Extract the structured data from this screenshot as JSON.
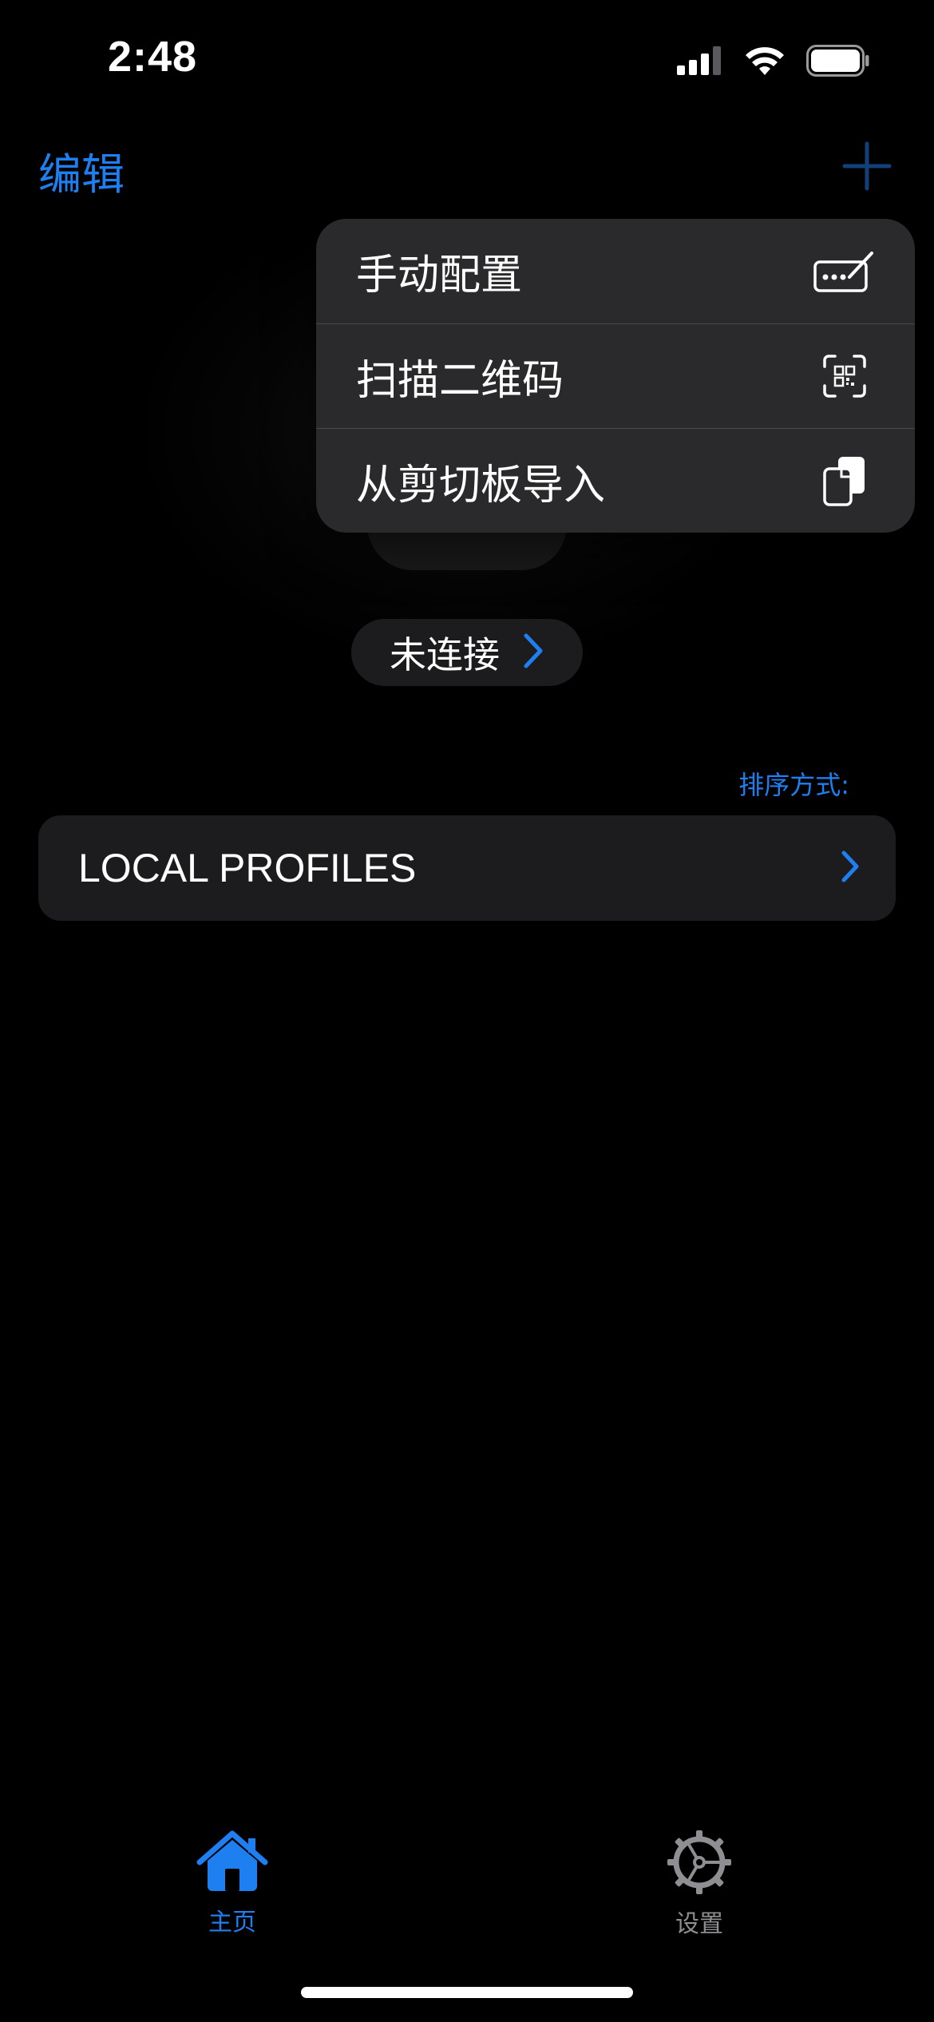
{
  "status_bar": {
    "time": "2:48",
    "signal_icon": "cellular-signal-icon",
    "wifi_icon": "wifi-icon",
    "battery_icon": "battery-icon"
  },
  "nav": {
    "edit_label": "编辑",
    "add_icon": "plus-icon"
  },
  "add_menu": {
    "items": [
      {
        "label": "手动配置",
        "icon": "edit-config-icon"
      },
      {
        "label": "扫描二维码",
        "icon": "qr-scan-icon"
      },
      {
        "label": "从剪切板导入",
        "icon": "clipboard-icon"
      }
    ]
  },
  "connection": {
    "status": "未连接"
  },
  "sort": {
    "label": "排序方式:"
  },
  "profiles": {
    "label": "LOCAL PROFILES"
  },
  "tab_bar": {
    "tabs": [
      {
        "label": "主页",
        "icon": "home-icon",
        "active": true
      },
      {
        "label": "设置",
        "icon": "gear-icon",
        "active": false
      }
    ]
  },
  "colors": {
    "accent": "#1e7ff0",
    "background": "#000000",
    "menu_background": "#2a2a2c",
    "card_background": "#1c1c1e",
    "inactive_tab": "#8e8e93"
  }
}
